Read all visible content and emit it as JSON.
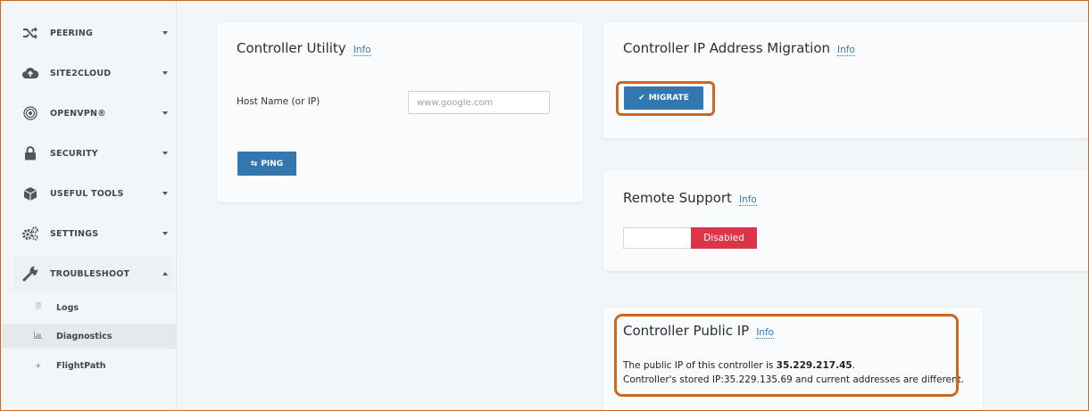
{
  "sidebar": {
    "items": [
      {
        "label": "PEERING",
        "icon": "shuffle-icon"
      },
      {
        "label": "SITE2CLOUD",
        "icon": "cloud-upload-icon"
      },
      {
        "label": "OPENVPN®",
        "icon": "openvpn-icon"
      },
      {
        "label": "SECURITY",
        "icon": "lock-icon"
      },
      {
        "label": "USEFUL TOOLS",
        "icon": "cube-icon"
      },
      {
        "label": "SETTINGS",
        "icon": "gears-icon"
      },
      {
        "label": "TROUBLESHOOT",
        "icon": "wrench-icon"
      }
    ],
    "subitems": [
      {
        "label": "Logs",
        "icon": "file-icon"
      },
      {
        "label": "Diagnostics",
        "icon": "bar-chart-icon"
      },
      {
        "label": "FlightPath",
        "icon": "plane-icon"
      }
    ]
  },
  "controller_utility": {
    "title": "Controller Utility",
    "info": "Info",
    "host_label": "Host Name (or IP)",
    "host_value": "",
    "host_placeholder": "www.google.com",
    "ping_label": "PING"
  },
  "ip_migration": {
    "title": "Controller IP Address Migration",
    "info": "Info",
    "migrate_label": "MIGRATE"
  },
  "remote_support": {
    "title": "Remote Support",
    "info": "Info",
    "state": "Disabled"
  },
  "public_ip": {
    "title": "Controller Public IP",
    "info": "Info",
    "line1_prefix": "The public IP of this controller is ",
    "ip": "35.229.217.45",
    "line1_suffix": ".",
    "line2": "Controller's stored IP:35.229.135.69 and current addresses are different."
  },
  "colors": {
    "accent_blue": "#3277b0",
    "danger_red": "#dc3448",
    "highlight_orange": "#d0671f"
  }
}
